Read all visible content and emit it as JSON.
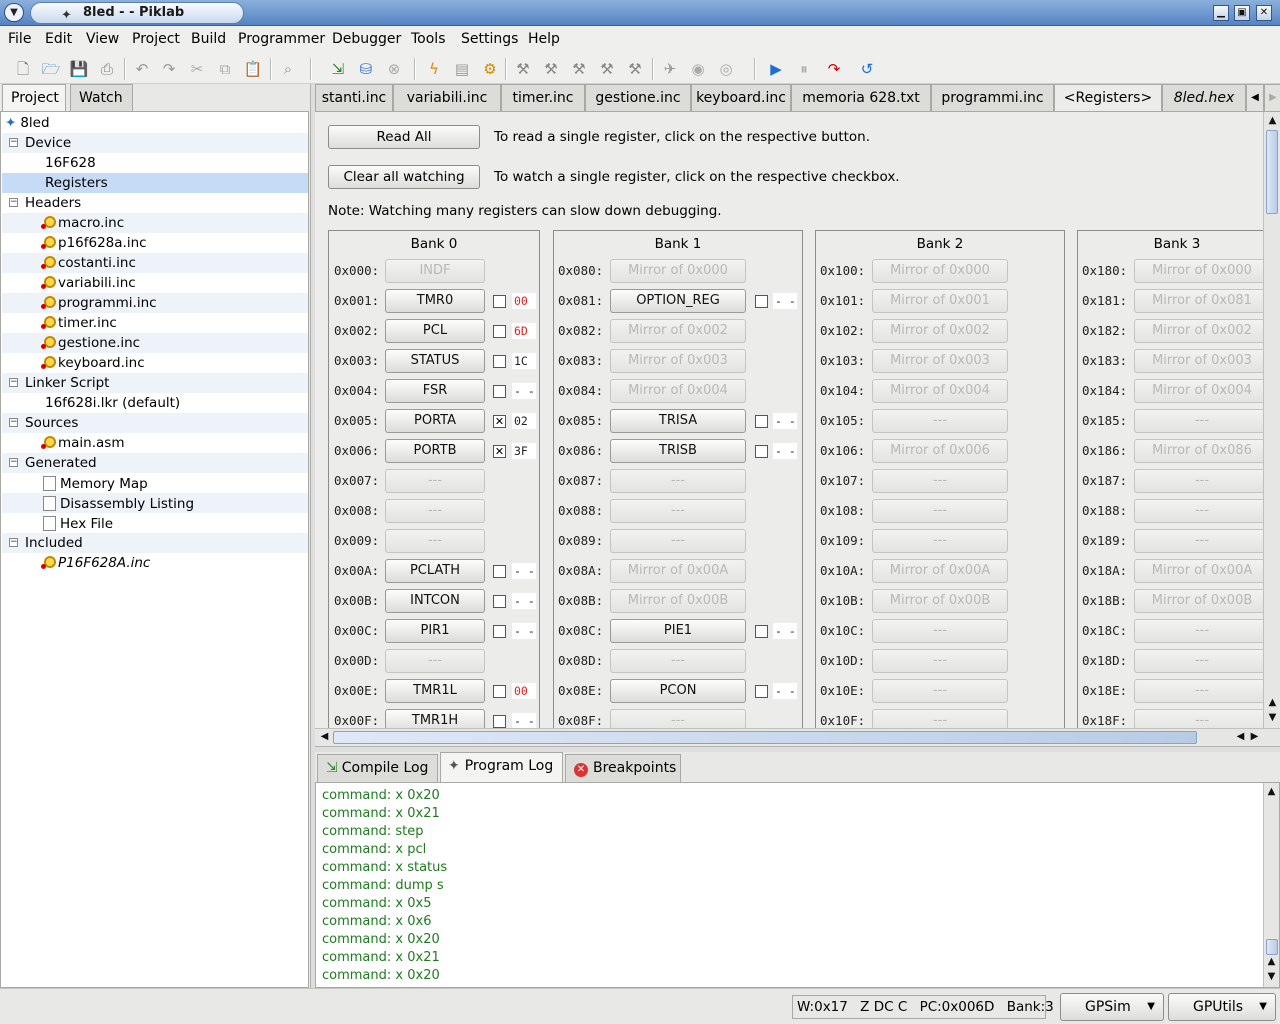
{
  "window": {
    "title": "8led -  - Piklab"
  },
  "menu": [
    "File",
    "Edit",
    "View",
    "Project",
    "Build",
    "Programmer",
    "Debugger",
    "Tools",
    "Settings",
    "Help"
  ],
  "left_tabs": [
    "Project",
    "Watch"
  ],
  "tree": {
    "root": "8led",
    "device_group": "Device",
    "device": "16F628",
    "registers": "Registers",
    "headers_group": "Headers",
    "headers": [
      "macro.inc",
      "p16f628a.inc",
      "costanti.inc",
      "variabili.inc",
      "programmi.inc",
      "timer.inc",
      "gestione.inc",
      "keyboard.inc"
    ],
    "linker_group": "Linker Script",
    "linker": "16f628i.lkr (default)",
    "sources_group": "Sources",
    "source": "main.asm",
    "generated_group": "Generated",
    "generated": [
      "Memory Map",
      "Disassembly Listing",
      "Hex File"
    ],
    "included_group": "Included",
    "included": "P16F628A.inc"
  },
  "doc_tabs": [
    "stanti.inc",
    "variabili.inc",
    "timer.inc",
    "gestione.inc",
    "keyboard.inc",
    "memoria 628.txt",
    "programmi.inc",
    "<Registers>",
    "8led.hex"
  ],
  "registers_view": {
    "read_all": "Read All",
    "clear_watching": "Clear all watching",
    "read_hint": "To read a single register, click on the respective button.",
    "watch_hint": "To watch a single register, click on the respective checkbox.",
    "note": "Note: Watching many registers can slow down debugging.",
    "banks": [
      {
        "title": "Bank 0",
        "rows": [
          {
            "addr": "0x000:",
            "name": "INDF",
            "enabled": false
          },
          {
            "addr": "0x001:",
            "name": "TMR0",
            "enabled": true,
            "checked": false,
            "value": "00",
            "red": true
          },
          {
            "addr": "0x002:",
            "name": "PCL",
            "enabled": true,
            "checked": false,
            "value": "6D",
            "red": true
          },
          {
            "addr": "0x003:",
            "name": "STATUS",
            "enabled": true,
            "checked": false,
            "value": "1C",
            "red": false
          },
          {
            "addr": "0x004:",
            "name": "FSR",
            "enabled": true,
            "checked": false,
            "value": "- -",
            "red": false
          },
          {
            "addr": "0x005:",
            "name": "PORTA",
            "enabled": true,
            "checked": true,
            "value": "02",
            "red": false
          },
          {
            "addr": "0x006:",
            "name": "PORTB",
            "enabled": true,
            "checked": true,
            "value": "3F",
            "red": false
          },
          {
            "addr": "0x007:",
            "name": "---",
            "enabled": false
          },
          {
            "addr": "0x008:",
            "name": "---",
            "enabled": false
          },
          {
            "addr": "0x009:",
            "name": "---",
            "enabled": false
          },
          {
            "addr": "0x00A:",
            "name": "PCLATH",
            "enabled": true,
            "checked": false,
            "value": "- -",
            "red": false
          },
          {
            "addr": "0x00B:",
            "name": "INTCON",
            "enabled": true,
            "checked": false,
            "value": "- -",
            "red": false
          },
          {
            "addr": "0x00C:",
            "name": "PIR1",
            "enabled": true,
            "checked": false,
            "value": "- -",
            "red": false
          },
          {
            "addr": "0x00D:",
            "name": "---",
            "enabled": false
          },
          {
            "addr": "0x00E:",
            "name": "TMR1L",
            "enabled": true,
            "checked": false,
            "value": "00",
            "red": true
          },
          {
            "addr": "0x00F:",
            "name": "TMR1H",
            "enabled": true,
            "checked": false,
            "value": "- -",
            "red": false
          }
        ]
      },
      {
        "title": "Bank 1",
        "rows": [
          {
            "addr": "0x080:",
            "name": "Mirror of 0x000",
            "enabled": false
          },
          {
            "addr": "0x081:",
            "name": "OPTION_REG",
            "enabled": true,
            "checked": false,
            "value": "- -",
            "red": false
          },
          {
            "addr": "0x082:",
            "name": "Mirror of 0x002",
            "enabled": false
          },
          {
            "addr": "0x083:",
            "name": "Mirror of 0x003",
            "enabled": false
          },
          {
            "addr": "0x084:",
            "name": "Mirror of 0x004",
            "enabled": false
          },
          {
            "addr": "0x085:",
            "name": "TRISA",
            "enabled": true,
            "checked": false,
            "value": "- -",
            "red": false
          },
          {
            "addr": "0x086:",
            "name": "TRISB",
            "enabled": true,
            "checked": false,
            "value": "- -",
            "red": false
          },
          {
            "addr": "0x087:",
            "name": "---",
            "enabled": false
          },
          {
            "addr": "0x088:",
            "name": "---",
            "enabled": false
          },
          {
            "addr": "0x089:",
            "name": "---",
            "enabled": false
          },
          {
            "addr": "0x08A:",
            "name": "Mirror of 0x00A",
            "enabled": false
          },
          {
            "addr": "0x08B:",
            "name": "Mirror of 0x00B",
            "enabled": false
          },
          {
            "addr": "0x08C:",
            "name": "PIE1",
            "enabled": true,
            "checked": false,
            "value": "- -",
            "red": false
          },
          {
            "addr": "0x08D:",
            "name": "---",
            "enabled": false
          },
          {
            "addr": "0x08E:",
            "name": "PCON",
            "enabled": true,
            "checked": false,
            "value": "- -",
            "red": false
          },
          {
            "addr": "0x08F:",
            "name": "---",
            "enabled": false
          }
        ]
      },
      {
        "title": "Bank 2",
        "rows": [
          {
            "addr": "0x100:",
            "name": "Mirror of 0x000",
            "enabled": false
          },
          {
            "addr": "0x101:",
            "name": "Mirror of 0x001",
            "enabled": false
          },
          {
            "addr": "0x102:",
            "name": "Mirror of 0x002",
            "enabled": false
          },
          {
            "addr": "0x103:",
            "name": "Mirror of 0x003",
            "enabled": false
          },
          {
            "addr": "0x104:",
            "name": "Mirror of 0x004",
            "enabled": false
          },
          {
            "addr": "0x105:",
            "name": "---",
            "enabled": false
          },
          {
            "addr": "0x106:",
            "name": "Mirror of 0x006",
            "enabled": false
          },
          {
            "addr": "0x107:",
            "name": "---",
            "enabled": false
          },
          {
            "addr": "0x108:",
            "name": "---",
            "enabled": false
          },
          {
            "addr": "0x109:",
            "name": "---",
            "enabled": false
          },
          {
            "addr": "0x10A:",
            "name": "Mirror of 0x00A",
            "enabled": false
          },
          {
            "addr": "0x10B:",
            "name": "Mirror of 0x00B",
            "enabled": false
          },
          {
            "addr": "0x10C:",
            "name": "---",
            "enabled": false
          },
          {
            "addr": "0x10D:",
            "name": "---",
            "enabled": false
          },
          {
            "addr": "0x10E:",
            "name": "---",
            "enabled": false
          },
          {
            "addr": "0x10F:",
            "name": "---",
            "enabled": false
          }
        ]
      },
      {
        "title": "Bank 3",
        "rows": [
          {
            "addr": "0x180:",
            "name": "Mirror of 0x000",
            "enabled": false
          },
          {
            "addr": "0x181:",
            "name": "Mirror of 0x081",
            "enabled": false
          },
          {
            "addr": "0x182:",
            "name": "Mirror of 0x002",
            "enabled": false
          },
          {
            "addr": "0x183:",
            "name": "Mirror of 0x003",
            "enabled": false
          },
          {
            "addr": "0x184:",
            "name": "Mirror of 0x004",
            "enabled": false
          },
          {
            "addr": "0x185:",
            "name": "---",
            "enabled": false
          },
          {
            "addr": "0x186:",
            "name": "Mirror of 0x086",
            "enabled": false
          },
          {
            "addr": "0x187:",
            "name": "---",
            "enabled": false
          },
          {
            "addr": "0x188:",
            "name": "---",
            "enabled": false
          },
          {
            "addr": "0x189:",
            "name": "---",
            "enabled": false
          },
          {
            "addr": "0x18A:",
            "name": "Mirror of 0x00A",
            "enabled": false
          },
          {
            "addr": "0x18B:",
            "name": "Mirror of 0x00B",
            "enabled": false
          },
          {
            "addr": "0x18C:",
            "name": "---",
            "enabled": false
          },
          {
            "addr": "0x18D:",
            "name": "---",
            "enabled": false
          },
          {
            "addr": "0x18E:",
            "name": "---",
            "enabled": false
          },
          {
            "addr": "0x18F:",
            "name": "---",
            "enabled": false
          }
        ]
      }
    ]
  },
  "bottom_tabs": [
    "Compile Log",
    "Program Log",
    "Breakpoints"
  ],
  "log_lines": [
    "command: x 0x20",
    "command: x 0x21",
    "command: step",
    "command: x pcl",
    "command: x status",
    "command: dump s",
    "command: x 0x5",
    "command: x 0x6",
    "command: x 0x20",
    "command: x 0x21",
    "command: x 0x20"
  ],
  "status": {
    "w": "W:0x17",
    "flags": "Z DC C",
    "pc": "PC:0x006D",
    "bank": "Bank:3",
    "debugger": "GPSim",
    "programmer": "GPUtils"
  },
  "colors": {
    "log_text": "#1f7a1f",
    "changed_value": "#e02020",
    "selection": "#c6dbf5"
  }
}
